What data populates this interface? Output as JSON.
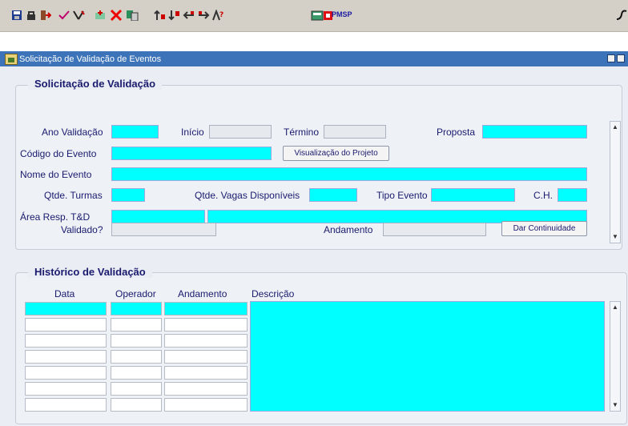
{
  "toolbar": {
    "icons": [
      "save-icon",
      "lock-icon",
      "exit-icon",
      "check-icon",
      "clear-icon",
      "new-record-icon",
      "delete-icon",
      "copy-icon",
      "first-record-icon",
      "last-record-icon",
      "previous-icon",
      "next-icon",
      "help-icon",
      "calculator-icon",
      "flag-icon"
    ],
    "app_label": "PMSP"
  },
  "window": {
    "title": "Solicitação de Validação de Eventos"
  },
  "solicitacao": {
    "section_title": "Solicitação de Validação",
    "ano_validacao_label": "Ano Validação",
    "inicio_label": "Início",
    "termino_label": "Término",
    "proposta_label": "Proposta",
    "codigo_evento_label": "Código do Evento",
    "visualizacao_button": "Visualização do Projeto",
    "nome_evento_label": "Nome do Evento",
    "qtde_turmas_label": "Qtde. Turmas",
    "qtde_vagas_label": "Qtde. Vagas Disponíveis",
    "tipo_evento_label": "Tipo Evento",
    "ch_label": "C.H.",
    "area_resp_label": "Área Resp. T&D",
    "validado_label": "Validado?",
    "andamento_label": "Andamento",
    "dar_continuidade_button": "Dar Continuidade"
  },
  "historico": {
    "section_title": "Histórico de Validação",
    "columns": [
      "Data",
      "Operador",
      "Andamento",
      "Descrição"
    ]
  },
  "colors": {
    "field_active": "#00ffff",
    "title_bar": "#3d74b9",
    "label_text": "#1a1a6e"
  }
}
